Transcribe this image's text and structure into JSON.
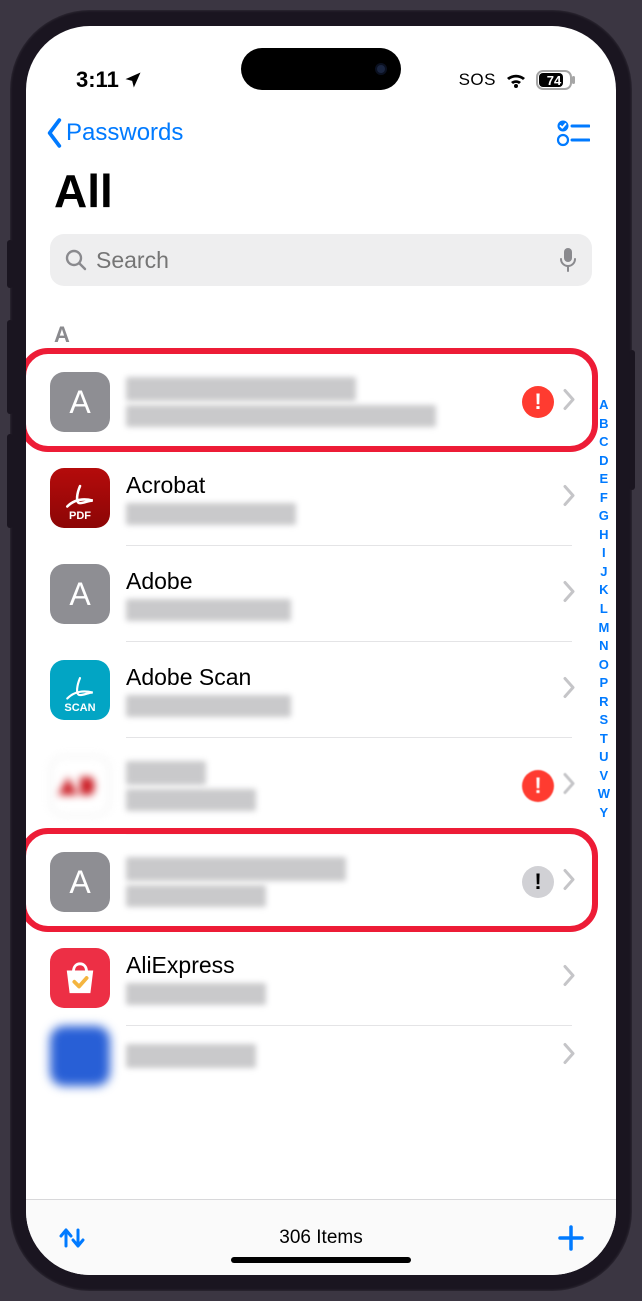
{
  "status": {
    "time": "3:11",
    "sos": "SOS",
    "battery_pct": "74"
  },
  "nav": {
    "back_label": "Passwords"
  },
  "header": {
    "title": "All"
  },
  "search": {
    "placeholder": "Search"
  },
  "section": {
    "letter": "A"
  },
  "rows": [
    {
      "title_visible": false,
      "title": "",
      "sub_visible": false,
      "icon": "gray-A",
      "warn": "red",
      "highlighted": true,
      "sub_width": 310
    },
    {
      "title_visible": true,
      "title": "Acrobat",
      "sub_visible": false,
      "icon": "acrobat",
      "warn": null,
      "highlighted": false,
      "sub_width": 170,
      "icon_sub": "PDF"
    },
    {
      "title_visible": true,
      "title": "Adobe",
      "sub_visible": false,
      "icon": "gray-A",
      "warn": null,
      "highlighted": false,
      "sub_width": 165
    },
    {
      "title_visible": true,
      "title": "Adobe Scan",
      "sub_visible": false,
      "icon": "scan",
      "warn": null,
      "highlighted": false,
      "sub_width": 165,
      "icon_sub": "SCAN"
    },
    {
      "title_visible": false,
      "title": "",
      "sub_visible": false,
      "icon": "adp",
      "warn": "red",
      "highlighted": false,
      "blurred_row": true,
      "sub_width": 130,
      "title_width": 80
    },
    {
      "title_visible": false,
      "title": "",
      "sub_visible": false,
      "icon": "gray-A",
      "warn": "gray",
      "highlighted": true,
      "sub_width": 140,
      "title_width": 220
    },
    {
      "title_visible": true,
      "title": "AliExpress",
      "sub_visible": false,
      "icon": "aliexpress",
      "warn": null,
      "highlighted": false,
      "sub_width": 140
    },
    {
      "title_visible": false,
      "title": "",
      "sub_visible": false,
      "icon": "blurbox",
      "warn": null,
      "highlighted": false,
      "partial": true,
      "sub_width": 0,
      "title_width": 130
    }
  ],
  "index_letters": [
    "A",
    "B",
    "C",
    "D",
    "E",
    "F",
    "G",
    "H",
    "I",
    "J",
    "K",
    "L",
    "M",
    "N",
    "O",
    "P",
    "R",
    "S",
    "T",
    "U",
    "V",
    "W",
    "Y"
  ],
  "footer": {
    "count_text": "306 Items"
  }
}
